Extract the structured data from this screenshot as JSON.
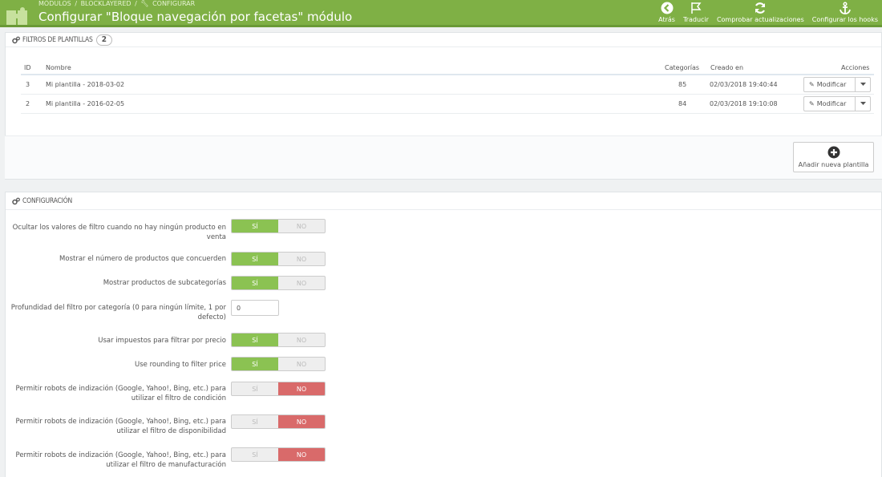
{
  "header": {
    "breadcrumb": [
      "Módulos",
      "/",
      "blocklayered",
      "/",
      "Configurar"
    ],
    "title": "Configurar \"Bloque navegación por facetas\" módulo",
    "toolbar": [
      {
        "label": "Atrás",
        "icon": "back-icon"
      },
      {
        "label": "Traducir",
        "icon": "flag-icon"
      },
      {
        "label": "Comprobar actualizaciones",
        "icon": "refresh-icon"
      },
      {
        "label": "Configurar los hooks",
        "icon": "anchor-icon"
      }
    ],
    "color": "#7fb045"
  },
  "filters": {
    "heading": "Filtros de plantillas",
    "count": "2",
    "columns": {
      "id": "ID",
      "name": "Nombre",
      "categories": "Categorías",
      "created": "Creado en",
      "actions": "Acciones"
    },
    "rows": [
      {
        "id": "3",
        "name": "Mi plantilla - 2018-03-02",
        "categories": "85",
        "created": "02/03/2018 19:40:44",
        "action": "Modificar"
      },
      {
        "id": "2",
        "name": "Mi plantilla - 2016-02-05",
        "categories": "84",
        "created": "02/03/2018 19:10:08",
        "action": "Modificar"
      }
    ],
    "add_label": "Añadir nueva plantilla"
  },
  "config": {
    "heading": "Configuración",
    "yes": "Sí",
    "no": "No",
    "fields": [
      {
        "label": "Ocultar los valores de filtro cuando no hay ningún producto en venta",
        "value": "yes"
      },
      {
        "label": "Mostrar el número de productos que concuerden",
        "value": "yes"
      },
      {
        "label": "Mostrar productos de subcategorías",
        "value": "yes"
      },
      {
        "label": "Profundidad del filtro por categoría (0 para ningún límite, 1 por defecto)",
        "value": "0"
      },
      {
        "label": "Usar impuestos para filtrar por precio",
        "value": "yes"
      },
      {
        "label": "Use rounding to filter price",
        "value": "yes"
      },
      {
        "label": "Permitir robots de indización (Google, Yahoo!, Bing, etc.) para utilizar el filtro de condición",
        "value": "no"
      },
      {
        "label": "Permitir robots de indización (Google, Yahoo!, Bing, etc.) para utilizar el filtro de disponibilidad",
        "value": "no"
      },
      {
        "label": "Permitir robots de indización (Google, Yahoo!, Bing, etc.) para utilizar el filtro de manufacturación",
        "value": "no"
      }
    ],
    "colors": {
      "yes": "#8bc252",
      "no": "#d96a6a"
    }
  }
}
